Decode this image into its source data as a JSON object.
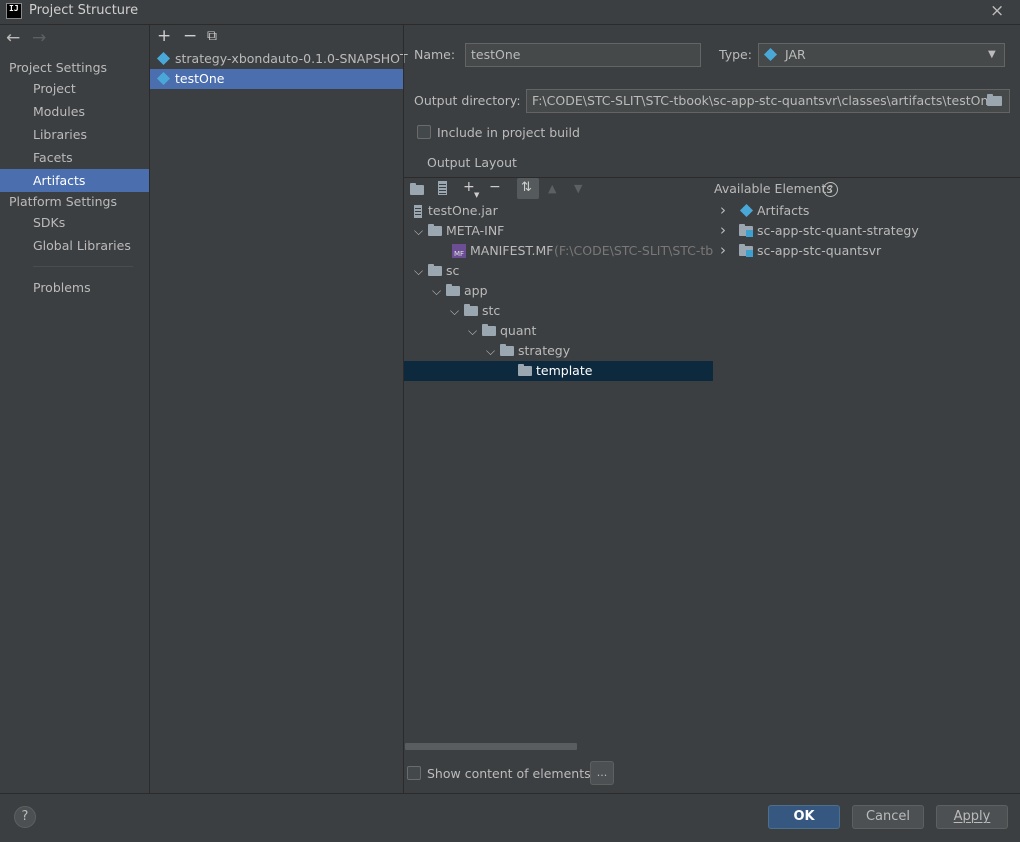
{
  "window": {
    "title": "Project Structure",
    "logo": "IJ",
    "close_icon": "×"
  },
  "nav": {
    "back": "←",
    "forward": "→"
  },
  "sidebar": {
    "project_settings_header": "Project Settings",
    "project_items": [
      {
        "label": "Project"
      },
      {
        "label": "Modules"
      },
      {
        "label": "Libraries"
      },
      {
        "label": "Facets"
      },
      {
        "label": "Artifacts",
        "selected": true
      }
    ],
    "platform_settings_header": "Platform Settings",
    "platform_items": [
      {
        "label": "SDKs"
      },
      {
        "label": "Global Libraries"
      }
    ],
    "problems": "Problems"
  },
  "artifacts_toolbar": {
    "add": "+",
    "remove": "−",
    "copy": "⧉"
  },
  "artifacts": [
    {
      "label": "strategy-xbondauto-0.1.0-SNAPSHOT"
    },
    {
      "label": "testOne",
      "selected": true
    }
  ],
  "detail": {
    "name_label": "Name:",
    "name_value": "testOne",
    "type_label": "Type:",
    "type_value": "JAR",
    "output_dir_label": "Output directory:",
    "output_dir_value": "F:\\CODE\\STC-SLIT\\STC-tbook\\sc-app-stc-quantsvr\\classes\\artifacts\\testOne",
    "include_label": "Include in project build",
    "output_layout_tab": "Output Layout"
  },
  "layout_tree": [
    {
      "text": "testOne.jar",
      "kind": "jar",
      "level": 0,
      "expanded": null
    },
    {
      "text": "META-INF",
      "kind": "folder",
      "level": 0,
      "expanded": true
    },
    {
      "text": "MANIFEST.MF",
      "suffix": "(F:\\CODE\\STC-SLIT\\STC-tbook",
      "kind": "mf",
      "level": 1,
      "expanded": null
    },
    {
      "text": "sc",
      "kind": "folder",
      "level": 0,
      "expanded": true
    },
    {
      "text": "app",
      "kind": "folder",
      "level": 1,
      "expanded": true
    },
    {
      "text": "stc",
      "kind": "folder",
      "level": 2,
      "expanded": true
    },
    {
      "text": "quant",
      "kind": "folder",
      "level": 3,
      "expanded": true
    },
    {
      "text": "strategy",
      "kind": "folder",
      "level": 4,
      "expanded": true
    },
    {
      "text": "template",
      "kind": "folder",
      "level": 5,
      "expanded": null,
      "selected": true
    }
  ],
  "available": {
    "title": "Available Elements",
    "help": "?",
    "items": [
      {
        "text": "Artifacts",
        "kind": "artifact"
      },
      {
        "text": "sc-app-stc-quant-strategy",
        "kind": "module"
      },
      {
        "text": "sc-app-stc-quantsvr",
        "kind": "module"
      }
    ]
  },
  "show_content_label": "Show content of elements",
  "ellipsis_button": "...",
  "footer": {
    "help": "?",
    "ok": "OK",
    "cancel": "Cancel",
    "apply": "Apply"
  }
}
